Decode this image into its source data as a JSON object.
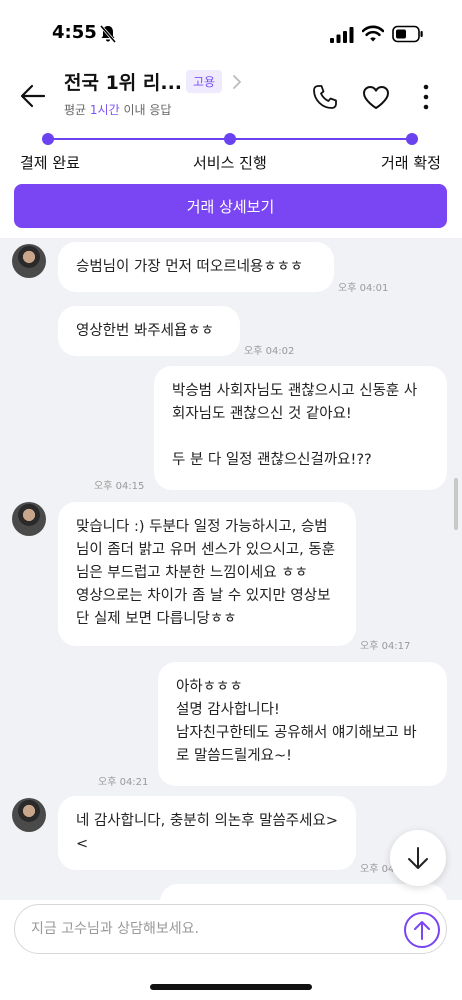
{
  "status_bar": {
    "time": "4:55"
  },
  "header": {
    "title": "전국 1위 리...",
    "badge": "고용",
    "subtitle_prefix": "평균 ",
    "subtitle_highlight": "1시간",
    "subtitle_suffix": " 이내 응답"
  },
  "progress": {
    "steps": [
      "결제 완료",
      "서비스 진행",
      "거래 확정"
    ]
  },
  "detail_button": "거래 상세보기",
  "messages": [
    {
      "side": "left",
      "text": "승범님이 가장 먼저 떠오르네용ㅎㅎㅎ",
      "time": "오후 04:01"
    },
    {
      "side": "left",
      "text": "영상한번 봐주세욥ㅎㅎ",
      "time": "오후 04:02"
    },
    {
      "side": "right",
      "text": "박승범 사회자님도 괜찮으시고 신동훈 사회자님도 괜찮으신 것 같아요!\n\n두 분 다 일정 괜찮으신걸까요!??",
      "time": "오후 04:15"
    },
    {
      "side": "left",
      "text": "맞습니다 :) 두분다 일정 가능하시고, 승범님이 좀더 밝고 유머 센스가 있으시고, 동훈님은 부드럽고 차분한 느낌이세요 ㅎㅎ\n영상으로는 차이가 좀 날 수 있지만 영상보단 실제 보면 다릅니당ㅎㅎ",
      "time": "오후 04:17"
    },
    {
      "side": "right",
      "text": "아하ㅎㅎㅎ\n설명 감사합니다!\n남자친구한테도 공유해서 얘기해보고 바로 말씀드릴게요~!",
      "time": "오후 04:21"
    },
    {
      "side": "left",
      "text": "네 감사합니다, 충분히 의논후 말씀주세요><",
      "time": "오후 04"
    }
  ],
  "input": {
    "placeholder": "지금 고수님과 상담해보세요."
  },
  "colors": {
    "accent": "#7a45f2",
    "chat_bg": "#f1f2f5"
  }
}
